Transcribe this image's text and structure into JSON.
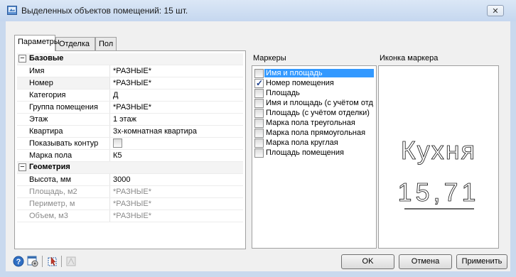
{
  "window": {
    "title": "Выделенных объектов помещений: 15 шт.",
    "close_icon": "close-icon"
  },
  "tabs": [
    {
      "label": "Параметры",
      "active": true
    },
    {
      "label": "Отделка",
      "active": false
    },
    {
      "label": "Пол",
      "active": false
    }
  ],
  "properties": {
    "base": {
      "category": "Базовые",
      "rows": [
        {
          "label": "Имя",
          "value": "*РАЗНЫЕ*"
        },
        {
          "label": "Номер",
          "value": "*РАЗНЫЕ*"
        },
        {
          "label": "Категория",
          "value": "Д"
        },
        {
          "label": "Группа помещения",
          "value": "*РАЗНЫЕ*"
        },
        {
          "label": "Этаж",
          "value": "1 этаж"
        },
        {
          "label": "Квартира",
          "value": "3х-комнатная квартира"
        },
        {
          "label": "Показывать контур",
          "value": ""
        },
        {
          "label": "Марка пола",
          "value": "К5"
        }
      ]
    },
    "geometry": {
      "category": "Геометрия",
      "rows": [
        {
          "label": "Высота, мм",
          "value": "3000"
        },
        {
          "label": "Площадь, м2",
          "value": "*РАЗНЫЕ*"
        },
        {
          "label": "Периметр, м",
          "value": "*РАЗНЫЕ*"
        },
        {
          "label": "Объем, м3",
          "value": "*РАЗНЫЕ*"
        }
      ]
    }
  },
  "markers": {
    "label": "Маркеры",
    "items": [
      {
        "label": "Имя и площадь",
        "checked": false,
        "selected": true
      },
      {
        "label": "Номер помещения",
        "checked": true,
        "selected": false
      },
      {
        "label": "Площадь",
        "checked": false,
        "selected": false
      },
      {
        "label": "Имя и площадь (с учётом отд",
        "checked": false,
        "selected": false
      },
      {
        "label": "Площадь (с учётом отделки)",
        "checked": false,
        "selected": false
      },
      {
        "label": "Марка пола треугольная",
        "checked": false,
        "selected": false
      },
      {
        "label": "Марка пола прямоугольная",
        "checked": false,
        "selected": false
      },
      {
        "label": "Марка пола круглая",
        "checked": false,
        "selected": false
      },
      {
        "label": "Площадь помещения",
        "checked": false,
        "selected": false
      }
    ]
  },
  "marker_icon": {
    "label": "Иконка маркера",
    "name_text": "Кухня",
    "area_text": "15,71"
  },
  "buttons": {
    "ok": "OK",
    "cancel": "Отмена",
    "apply": "Применить"
  },
  "toolbar_icons": [
    "help-icon",
    "settings-icon",
    "pick-objects-icon",
    "disabled-tool-icon"
  ],
  "colors": {
    "selection": "#3399ff",
    "frame": "#c9d9ee",
    "client": "#f0f0f0"
  }
}
